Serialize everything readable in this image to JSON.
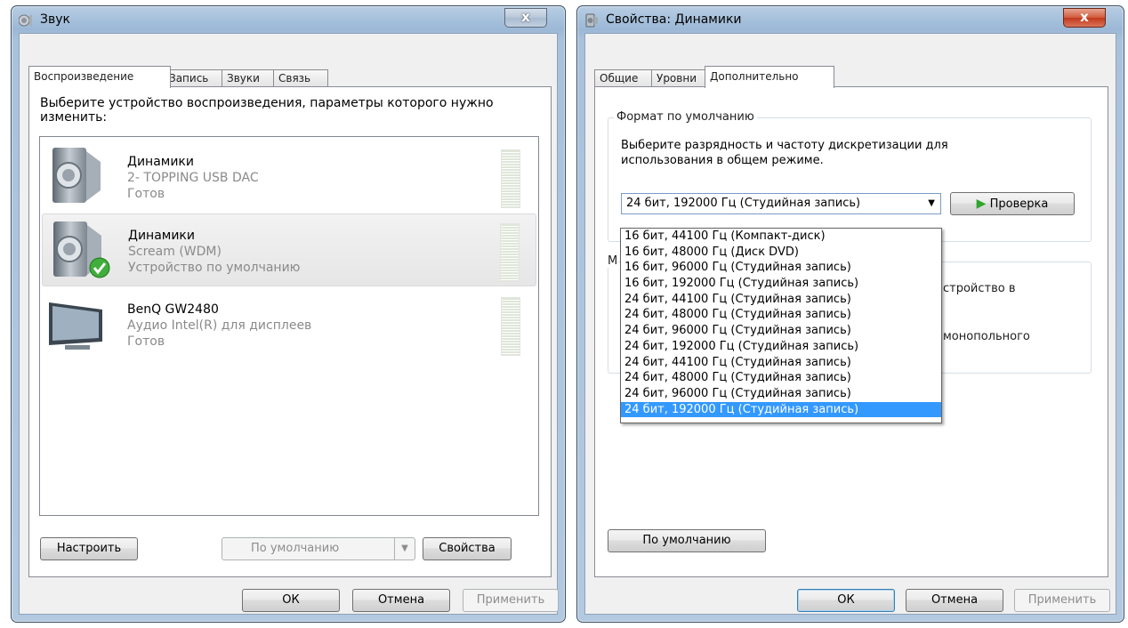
{
  "left_window": {
    "title": "Звук",
    "close_label": "x",
    "tabs": [
      "Воспроизведение",
      "Запись",
      "Звуки",
      "Связь"
    ],
    "instruction": "Выберите устройство воспроизведения, параметры которого нужно изменить:",
    "devices": [
      {
        "name": "Динамики",
        "description": "2- TOPPING USB DAC",
        "status": "Готов"
      },
      {
        "name": "Динамики",
        "description": "Scream (WDM)",
        "status": "Устройство по умолчанию"
      },
      {
        "name": "BenQ GW2480",
        "description": "Аудио Intel(R) для дисплеев",
        "status": "Готов"
      }
    ],
    "configure_label": "Настроить",
    "set_default_label": "По умолчанию",
    "properties_label": "Свойства",
    "ok_label": "ОК",
    "cancel_label": "Отмена",
    "apply_label": "Применить"
  },
  "right_window": {
    "title": "Свойства: Динамики",
    "close_label": "x",
    "tabs": [
      "Общие",
      "Уровни",
      "Дополнительно"
    ],
    "default_format_group": "Формат по умолчанию",
    "format_instruction": "Выберите разрядность и частоту дискретизации для использования в общем режиме.",
    "selected_format": "24 бит, 192000 Гц (Студийная запись)",
    "test_label": "Проверка",
    "format_options": [
      "16 бит, 44100 Гц (Компакт-диск)",
      "16 бит, 48000 Гц (Диск DVD)",
      "16 бит, 96000 Гц (Студийная запись)",
      "16 бит, 192000 Гц (Студийная запись)",
      "24 бит, 44100 Гц (Студийная запись)",
      "24 бит, 48000 Гц (Студийная запись)",
      "24 бит, 96000 Гц (Студийная запись)",
      "24 бит, 192000 Гц (Студийная запись)",
      "24 бит, 44100 Гц (Студийная запись)",
      "24 бит, 48000 Гц (Студийная запись)",
      "24 бит, 96000 Гц (Студийная запись)",
      "24 бит, 192000 Гц (Студийная запись)"
    ],
    "hidden_fragment_1": "стройство в",
    "hidden_fragment_2": "монопольного",
    "hidden_fragment_3": "М",
    "restore_defaults_label": "По умолчанию",
    "ok_label": "ОК",
    "cancel_label": "Отмена",
    "apply_label": "Применить"
  }
}
